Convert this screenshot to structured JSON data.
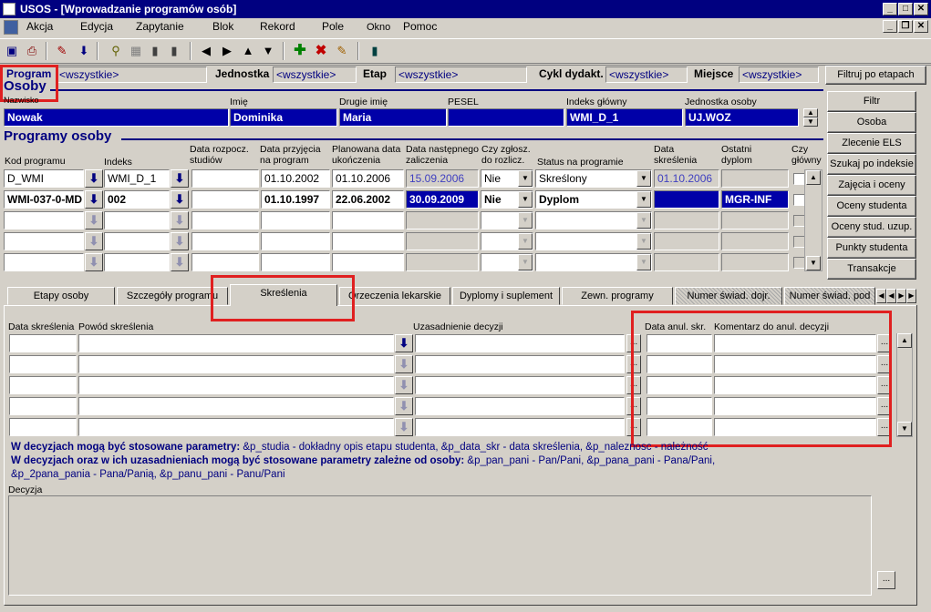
{
  "window": {
    "title": "USOS - [Wprowadzanie programów osób]"
  },
  "menu": [
    "Akcja",
    "Edycja",
    "Zapytanie",
    "Blok",
    "Rekord",
    "Pole",
    "Okno",
    "Pomoc"
  ],
  "filter": {
    "program_label": "Program",
    "program_value": "<wszystkie>",
    "unit_label": "Jednostka",
    "unit_value": "<wszystkie>",
    "stage_label": "Etap",
    "stage_value": "<wszystkie>",
    "cycle_label": "Cykl dydakt.",
    "cycle_value": "<wszystkie>",
    "place_label": "Miejsce",
    "place_value": "<wszystkie>",
    "button": "Filtruj po etapach"
  },
  "osoby": {
    "section": "Osoby",
    "h_nazwisko": "Nazwisko",
    "h_imie": "Imię",
    "h_drugie": "Drugie imię",
    "h_pesel": "PESEL",
    "h_indeks": "Indeks główny",
    "h_jednostka": "Jednostka osoby",
    "nazwisko": "Nowak",
    "imie": "Dominika",
    "drugie": "Maria",
    "pesel": "",
    "indeks": "WMI_D_1",
    "jednostka": "UJ.WOZ"
  },
  "side_buttons": [
    "Filtr",
    "Osoba",
    "Zlecenie ELS",
    "Szukaj po indeksie",
    "Zajęcia i oceny",
    "Oceny studenta",
    "Oceny stud. uzup.",
    "Punkty studenta",
    "Transakcje"
  ],
  "programy": {
    "section": "Programy osoby",
    "h_kod": "Kod programu",
    "h_indeks": "Indeks",
    "h_data_rozp": "Data rozpocz. studiów",
    "h_data_przyj": "Data przyjęcia na program",
    "h_plan": "Planowana data ukończenia",
    "h_nast": "Data następnego zaliczenia",
    "h_zglosz": "Czy zgłosz. do rozlicz.",
    "h_status": "Status na programie",
    "h_skresl": "Data skreślenia",
    "h_dyplom": "Ostatni dyplom",
    "h_glowny": "Czy główny",
    "rows": [
      {
        "kod": "D_WMI",
        "indeks": "WMI_D_1",
        "rozp": "",
        "przyj": "01.10.2002",
        "plan": "01.10.2006",
        "nast": "15.09.2006",
        "zglosz": "Nie",
        "status": "Skreślony",
        "skresl": "01.10.2006",
        "dyplom": ""
      },
      {
        "kod": "WMI-037-0-MD",
        "indeks": "002",
        "rozp": "",
        "przyj": "01.10.1997",
        "plan": "22.06.2002",
        "nast": "30.09.2009",
        "zglosz": "Nie",
        "status": "Dyplom",
        "skresl": "",
        "dyplom": "MGR-INF"
      }
    ]
  },
  "tabs": [
    "Etapy osoby",
    "Szczegóły programu",
    "Skreślenia",
    "Orzeczenia lekarskie",
    "Dyplomy i suplement",
    "Zewn. programy",
    "Numer świad. dojr.",
    "Numer świad. pod"
  ],
  "skreslenia": {
    "h_data": "Data skreślenia",
    "h_powod": "Powód skreślenia",
    "h_uzas": "Uzasadnienie decyzji",
    "h_anul": "Data anul. skr.",
    "h_koment": "Komentarz do anul. decyzji"
  },
  "info": {
    "line1_bold": "W decyzjach mogą być stosowane parametry:",
    "line1": "&p_studia - dokładny opis etapu studenta, &p_data_skr - data skreślenia, &p_naleznosc - należność",
    "line2_bold": "W decyzjach oraz w ich uzasadnieniach mogą być stosowane parametry zależne od osoby:",
    "line2": "&p_pan_pani - Pan/Pani, &p_pana_pani - Pana/Pani,",
    "line3": "&p_2pana_pania - Pana/Panią, &p_panu_pani - Panu/Pani"
  },
  "decyzja": {
    "label": "Decyzja",
    "value": ""
  },
  "ellipsis": "..."
}
